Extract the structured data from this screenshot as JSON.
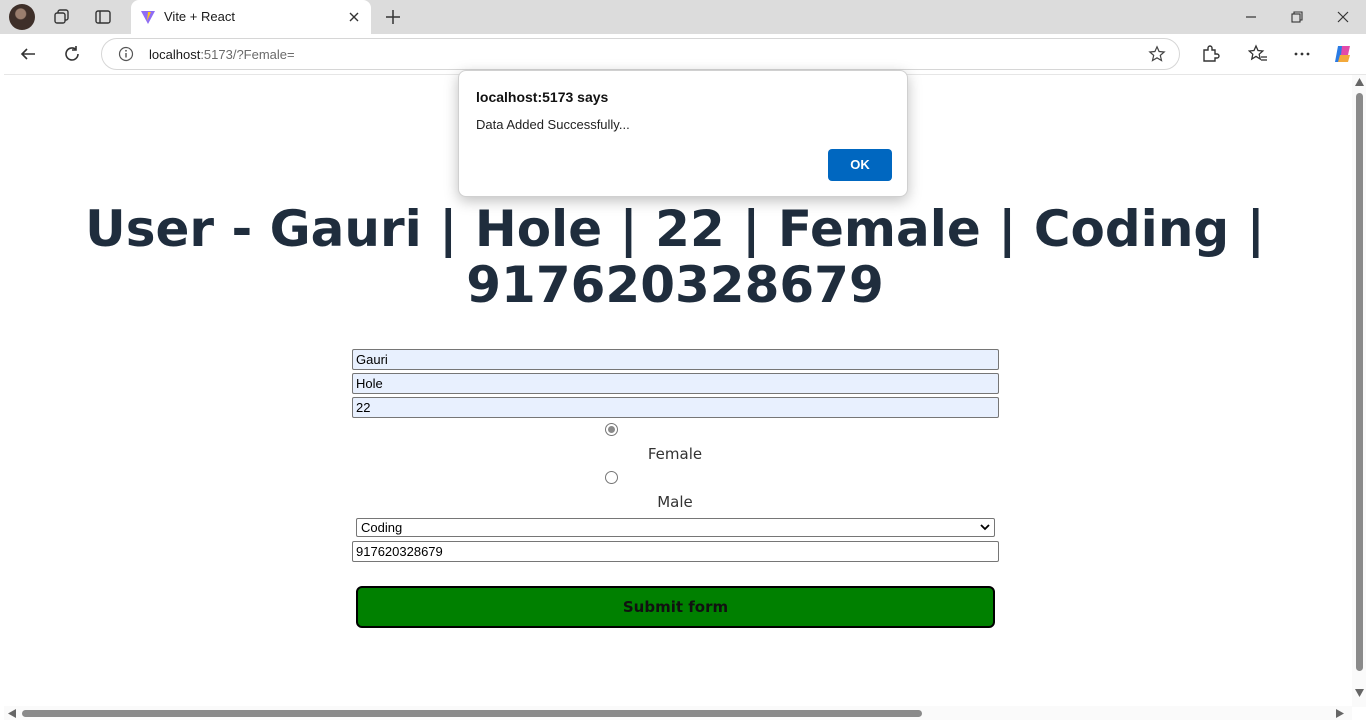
{
  "browser": {
    "tab_title": "Vite + React",
    "url_host": "localhost",
    "url_rest": ":5173/?Female=",
    "icons": [
      "avatar",
      "workspaces-icon",
      "tab-actions-icon",
      "vite-favicon",
      "close-icon",
      "plus-icon",
      "minimize-icon",
      "restore-icon",
      "window-close-icon",
      "back-icon",
      "reload-icon",
      "info-icon",
      "star-icon",
      "extensions-icon",
      "favorites-icon",
      "more-icon",
      "copilot-icon"
    ]
  },
  "page": {
    "heading_line1": "User - Gauri | Hole | 22 | Female | Coding |",
    "heading_line2": "917620328679",
    "form": {
      "first_name": "Gauri",
      "last_name": "Hole",
      "age": "22",
      "gender_options": [
        {
          "label": "Female",
          "checked": true
        },
        {
          "label": "Male",
          "checked": false
        }
      ],
      "hobby_selected": "Coding",
      "phone": "917620328679",
      "submit_label": "Submit form"
    }
  },
  "dialog": {
    "title": "localhost:5173 says",
    "message": "Data Added Successfully...",
    "ok_label": "OK"
  },
  "colors": {
    "heading": "#1f2d3d",
    "submit_bg": "#008000",
    "ok_button": "#0067c0"
  }
}
